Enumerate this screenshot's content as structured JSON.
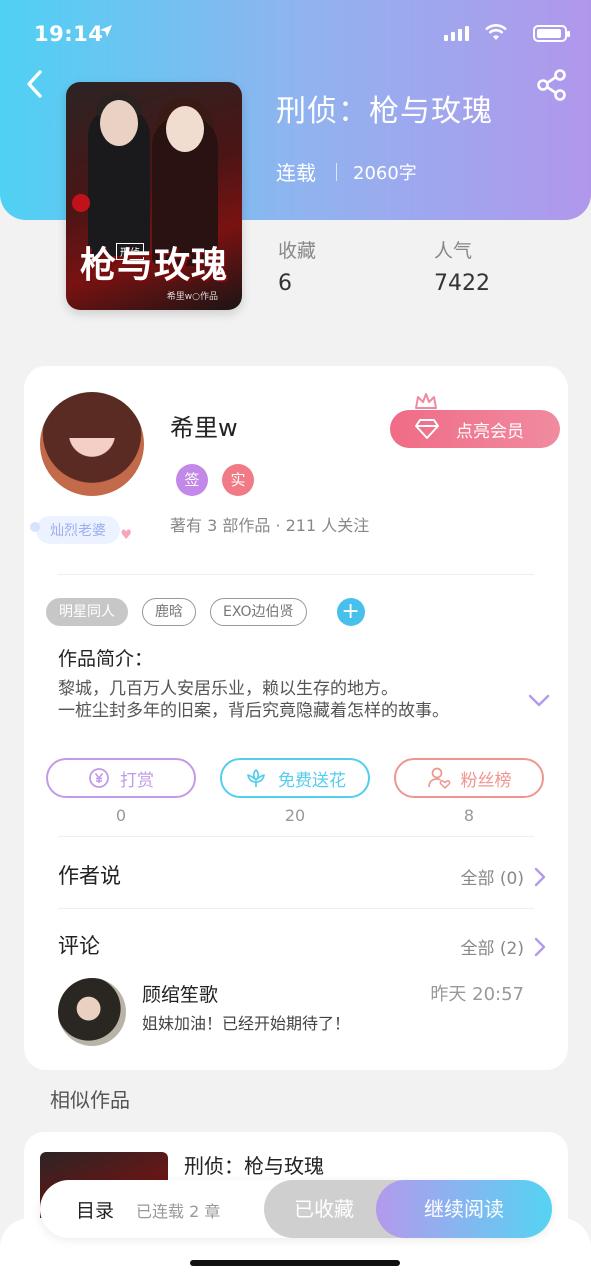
{
  "status_bar": {
    "time": "19:14"
  },
  "book": {
    "title": "刑侦：枪与玫瑰",
    "status": "连载",
    "word_count": "2060字",
    "favorites_label": "收藏",
    "favorites_value": "6",
    "popularity_label": "人气",
    "popularity_value": "7422",
    "cover": {
      "series_tag": "刑侦",
      "title": "枪与玫瑰",
      "author": "希里w○作品"
    }
  },
  "author": {
    "name": "希里w",
    "chips": [
      {
        "label": "签",
        "color": "#c289e8"
      },
      {
        "label": "实",
        "color": "#f07a86"
      }
    ],
    "fan_badge": "灿烈老婆",
    "stats": "著有 3 部作品 · 211 人关注",
    "vip_button": "点亮会员"
  },
  "tags": [
    "明星同人",
    "鹿晗",
    "EXO边伯贤"
  ],
  "intro": {
    "title": "作品简介：",
    "lines": [
      "黎城，几百万人安居乐业，赖以生存的地方。",
      "一桩尘封多年的旧案，背后究竟隐藏着怎样的故事。"
    ]
  },
  "actions": [
    {
      "label": "打赏",
      "count": "0",
      "color": "#c39ae8"
    },
    {
      "label": "免费送花",
      "count": "20",
      "color": "#54cdee"
    },
    {
      "label": "粉丝榜",
      "count": "8",
      "color": "#f0958f"
    }
  ],
  "author_says": {
    "title": "作者说",
    "more": "全部 (0)"
  },
  "comments": {
    "title": "评论",
    "more": "全部 (2)",
    "items": [
      {
        "user": "顾绾笙歌",
        "time": "昨天 20:57",
        "text": "姐妹加油！已经开始期待了！"
      }
    ]
  },
  "similar": {
    "title": "相似作品",
    "items": [
      {
        "name": "刑侦：枪与玫瑰"
      }
    ]
  },
  "bottom_bar": {
    "toc": "目录",
    "toc_sub": "已连载 2 章",
    "favorited": "已收藏",
    "continue": "继续阅读"
  }
}
